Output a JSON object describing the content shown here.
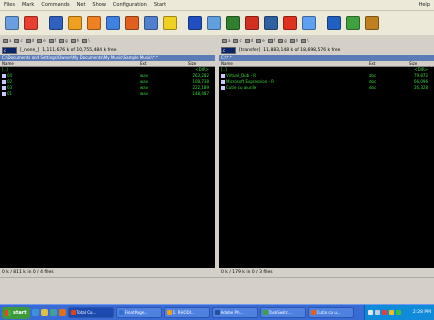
{
  "menubar": {
    "items": [
      "Files",
      "Mark",
      "Commands",
      "Net",
      "Show",
      "Configuration",
      "Start"
    ],
    "right_item": "Help"
  },
  "toolbar": {
    "icons": [
      {
        "name": "refresh-icon",
        "color": "#6aa0e0"
      },
      {
        "name": "brief-view-icon",
        "color": "#e84030"
      },
      {
        "name": "full-view-icon",
        "color": "#3060c0"
      },
      {
        "name": "tree-icon",
        "color": "#f0a020"
      },
      {
        "name": "sort-icon",
        "color": "#f08020"
      },
      {
        "name": "invert-selection-icon",
        "color": "#4080e0"
      },
      {
        "name": "pack-icon",
        "color": "#e06020"
      },
      {
        "name": "unpack-icon",
        "color": "#5080d0"
      },
      {
        "name": "find-icon",
        "color": "#f0d020"
      },
      {
        "name": "rename-icon",
        "color": "#2050c0"
      },
      {
        "name": "multi-rename-icon",
        "color": "#60a0e0"
      },
      {
        "name": "ftp-connect-icon",
        "color": "#308030"
      },
      {
        "name": "ftp-new-icon",
        "color": "#d03020"
      },
      {
        "name": "sync-icon",
        "color": "#3060a0"
      },
      {
        "name": "compare-icon",
        "color": "#e03020"
      },
      {
        "name": "notepad-icon",
        "color": "#60a0f0"
      },
      {
        "name": "copy-names-icon",
        "color": "#2060c0"
      },
      {
        "name": "cmd-icon",
        "color": "#40a040"
      },
      {
        "name": "settings-icon",
        "color": "#c08020"
      }
    ]
  },
  "left_panel": {
    "drive": "c",
    "drive_label": "[_none_]",
    "free_info": "1,111,676 k of 10,755,484 k free",
    "path": "C:\\Documents and Settings\\Owner\\My Documents\\My Music\\Sample Music\\*.*",
    "columns": {
      "name": "Name",
      "ext": "Ext",
      "size": "Size"
    },
    "files": [
      {
        "name": "[..]",
        "ext": "",
        "size": "<DIR>"
      },
      {
        "name": "04",
        "ext": "wav",
        "size": "263,282"
      },
      {
        "name": "02",
        "ext": "wav",
        "size": "108,738"
      },
      {
        "name": "03",
        "ext": "wav",
        "size": "222,189"
      },
      {
        "name": "01",
        "ext": "wav",
        "size": "148,487"
      }
    ],
    "status": "0 k / 811 k in 0 / 4 files"
  },
  "right_panel": {
    "drive": "c",
    "drive_label": "[transfer]",
    "free_info": "11,883,148 k of 18,698,576 k free",
    "path": "C:\\*.*",
    "columns": {
      "name": "Name",
      "ext": "Ext",
      "size": "Size"
    },
    "files": [
      {
        "name": "[..]",
        "ext": "",
        "size": "<DIR>"
      },
      {
        "name": "Virtual_Dub - R",
        "ext": "doc",
        "size": "79,872"
      },
      {
        "name": "Microsoft Expression - R",
        "ext": "doc",
        "size": "66,096"
      },
      {
        "name": "Cutie cu aiurile",
        "ext": "doc",
        "size": "26,328"
      }
    ],
    "status": "0 k / 179 k in 0 / 3 files"
  },
  "taskbar": {
    "start_label": "start",
    "items": [
      {
        "label": "Total Co...",
        "active": true
      },
      {
        "label": "FrontPage...",
        "active": false
      },
      {
        "label": "1. RHODI...",
        "active": false
      },
      {
        "label": "Adobe Ph...",
        "active": false
      },
      {
        "label": "TaskSwitc...",
        "active": false
      },
      {
        "label": "Cutia cu u...",
        "active": false
      }
    ],
    "clock": "2:28 PM"
  }
}
